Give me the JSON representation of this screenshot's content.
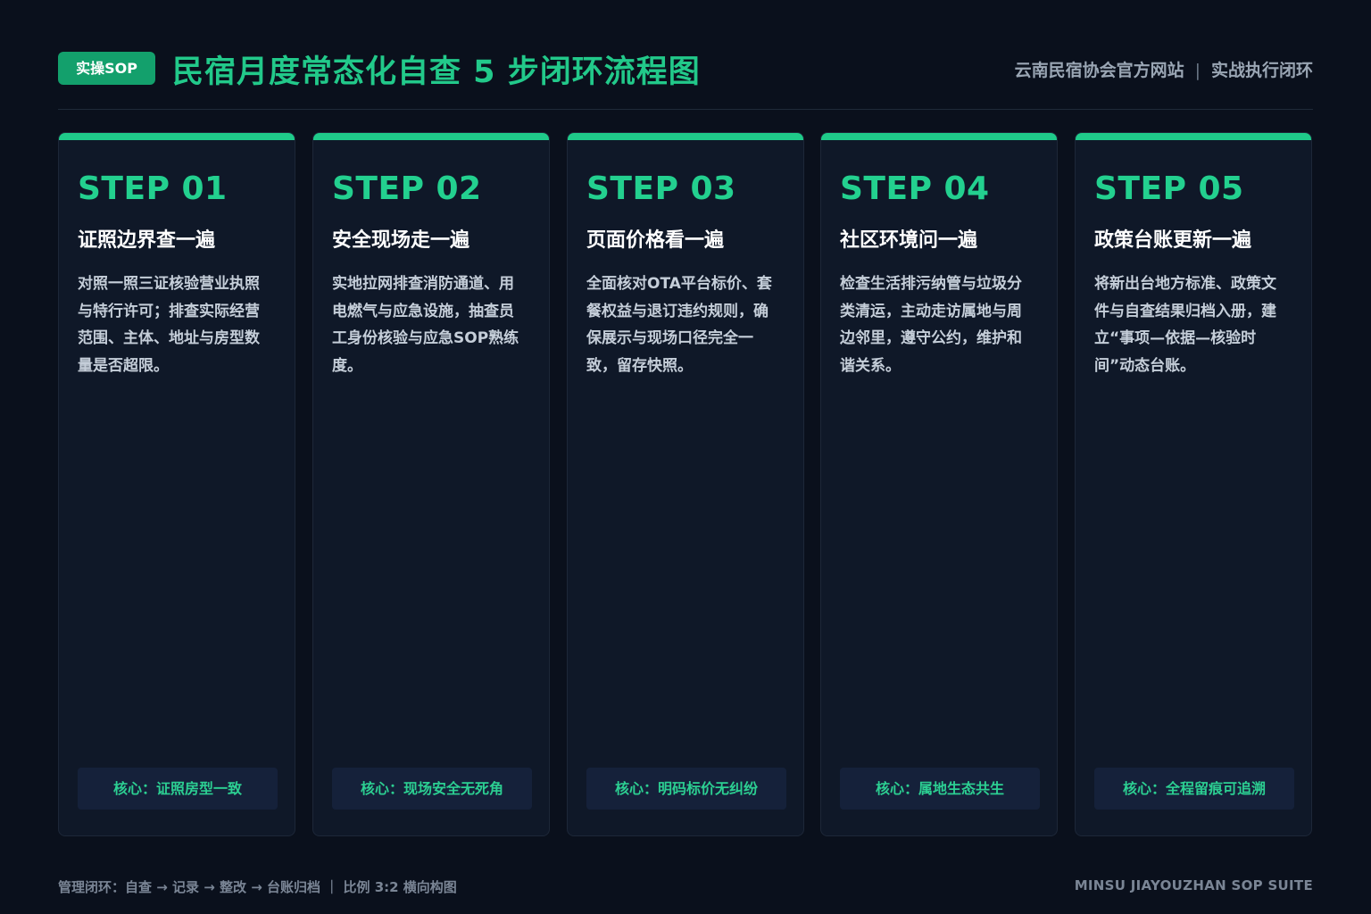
{
  "header": {
    "badge": "实操SOP",
    "title": "民宿月度常态化自查 5 步闭环流程图",
    "site": "云南民宿协会官方网站",
    "separator": "|",
    "tagline": "实战执行闭环"
  },
  "steps": [
    {
      "step": "STEP 01",
      "title": "证照边界查一遍",
      "desc": "对照一照三证核验营业执照与特行许可；排查实际经营范围、主体、地址与房型数量是否超限。",
      "core": "核心：证照房型一致"
    },
    {
      "step": "STEP 02",
      "title": "安全现场走一遍",
      "desc": "实地拉网排查消防通道、用电燃气与应急设施，抽查员工身份核验与应急SOP熟练度。",
      "core": "核心：现场安全无死角"
    },
    {
      "step": "STEP 03",
      "title": "页面价格看一遍",
      "desc": "全面核对OTA平台标价、套餐权益与退订违约规则，确保展示与现场口径完全一致，留存快照。",
      "core": "核心：明码标价无纠纷"
    },
    {
      "step": "STEP 04",
      "title": "社区环境问一遍",
      "desc": "检查生活排污纳管与垃圾分类清运，主动走访属地与周边邻里，遵守公约，维护和谐关系。",
      "core": "核心：属地生态共生"
    },
    {
      "step": "STEP 05",
      "title": "政策台账更新一遍",
      "desc": "将新出台地方标准、政策文件与自查结果归档入册，建立“事项—依据—核验时间”动态台账。",
      "core": "核心：全程留痕可追溯"
    }
  ],
  "footer": {
    "left": "管理闭环：自查 → 记录 → 整改 → 台账归档 ｜ 比例 3:2 横向构图",
    "right": "MINSU JIAYOUZHAN SOP SUITE"
  },
  "colors": {
    "background": "#0a101c",
    "card": "#0f1828",
    "accent": "#1fcb8a",
    "badge": "#13a06c"
  }
}
